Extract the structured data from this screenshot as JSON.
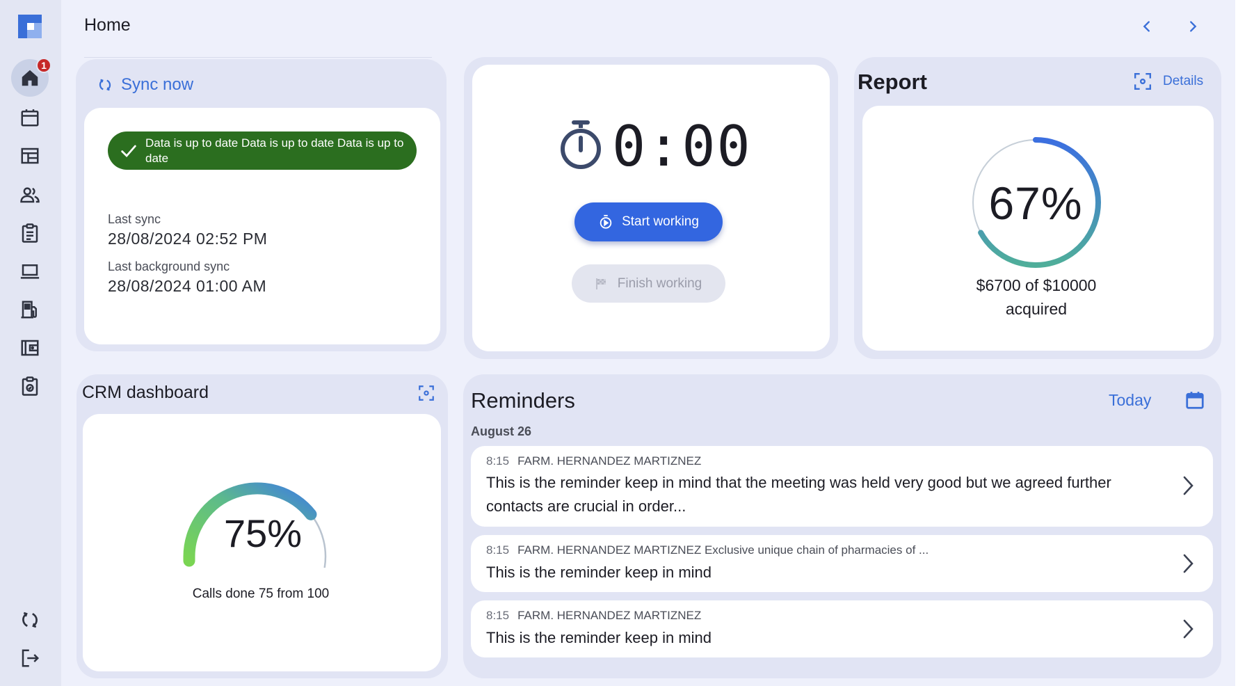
{
  "header": {
    "title": "Home"
  },
  "sidebar": {
    "home_badge": "1",
    "items": [
      {
        "name": "home",
        "icon": "home-icon"
      },
      {
        "name": "calendar",
        "icon": "calendar-icon"
      },
      {
        "name": "table",
        "icon": "table-icon"
      },
      {
        "name": "contacts",
        "icon": "people-icon"
      },
      {
        "name": "tasks",
        "icon": "clipboard-icon"
      },
      {
        "name": "devices",
        "icon": "laptop-icon"
      },
      {
        "name": "fuel",
        "icon": "fuel-icon"
      },
      {
        "name": "wallet",
        "icon": "wallet-icon"
      },
      {
        "name": "orders",
        "icon": "clipboard-check-icon"
      },
      {
        "name": "sync",
        "icon": "sync-icon"
      },
      {
        "name": "logout",
        "icon": "logout-icon"
      }
    ]
  },
  "sync_card": {
    "sync_label": "Sync now",
    "status": "Data is up to date Data is up to date Data is up to date",
    "last_sync_label": "Last sync",
    "last_sync_value": "28/08/2024 02:52 PM",
    "last_bg_sync_label": "Last background sync",
    "last_bg_sync_value": "28/08/2024 01:00 AM"
  },
  "timer_card": {
    "time": "0:00",
    "start_label": "Start working",
    "finish_label": "Finish working"
  },
  "report_card": {
    "title": "Report",
    "details_label": "Details",
    "progress": 0.67,
    "percent_label": "67%",
    "caption_line1": "$6700 of $10000",
    "caption_line2": "acquired"
  },
  "crm_card": {
    "title": "CRM dashboard",
    "progress": 0.75,
    "percent_label": "75%",
    "caption": "Calls done  75 from 100"
  },
  "reminders": {
    "title": "Reminders",
    "today_label": "Today",
    "date_group": "August 26",
    "items": [
      {
        "time": "8:15",
        "client": "FARM. HERNANDEZ MARTIZNEZ",
        "text": "This is the reminder keep in mind that the meeting was held very good but we agreed further contacts are crucial in order..."
      },
      {
        "time": "8:15",
        "client": "FARM. HERNANDEZ MARTIZNEZ Exclusive unique chain of pharmacies of ...",
        "text": "This is the reminder keep in mind"
      },
      {
        "time": "8:15",
        "client": "FARM. HERNANDEZ MARTIZNEZ",
        "text": "This is the reminder keep in mind"
      }
    ]
  },
  "colors": {
    "accent": "#3366e0",
    "link": "#3a6fd8",
    "success": "#2b6e1f",
    "badge": "#c62828"
  }
}
